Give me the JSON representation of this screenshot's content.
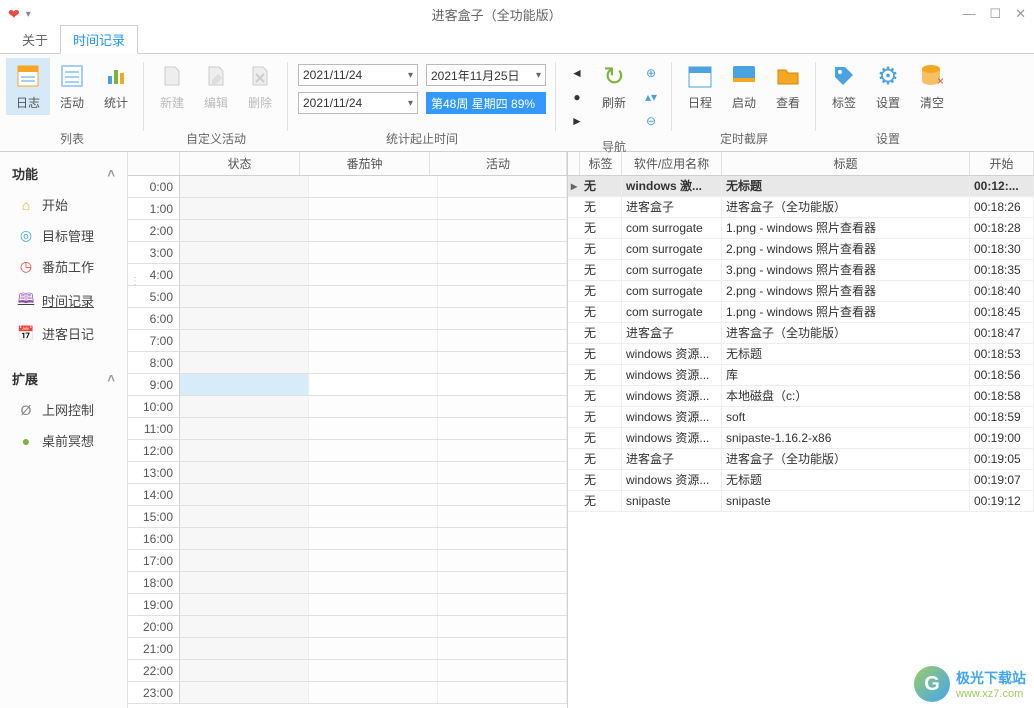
{
  "window": {
    "title": "进客盒子（全功能版）",
    "min": "—",
    "max": "☐",
    "close": "✕"
  },
  "tabs": {
    "about": "关于",
    "timelog": "时间记录"
  },
  "ribbon": {
    "list": {
      "label": "列表",
      "log": "日志",
      "activity": "活动",
      "stats": "统计"
    },
    "custom": {
      "label": "自定义活动",
      "new": "新建",
      "edit": "编辑",
      "del": "删除"
    },
    "stattime": {
      "label": "统计起止时间",
      "date1": "2021/11/24",
      "date2": "2021/11/24",
      "date3": "2021年11月25日",
      "week": "第48周 星期四 89%"
    },
    "nav": {
      "label": "导航",
      "refresh": "刷新"
    },
    "screenshot": {
      "label": "定时截屏",
      "calendar": "日程",
      "start": "启动",
      "view": "查看"
    },
    "settings": {
      "label": "设置",
      "tag": "标签",
      "set": "设置",
      "clear": "清空"
    }
  },
  "sidebar": {
    "func_hdr": "功能",
    "ext_hdr": "扩展",
    "items": [
      {
        "icon": "home-icon",
        "glyph": "⌂",
        "label": "开始"
      },
      {
        "icon": "target-icon",
        "glyph": "◎",
        "label": "目标管理"
      },
      {
        "icon": "tomato-icon",
        "glyph": "◷",
        "label": "番茄工作"
      },
      {
        "icon": "timelog-icon",
        "glyph": "🕮",
        "label": "时间记录"
      },
      {
        "icon": "diary-icon",
        "glyph": "📅",
        "label": "进客日记"
      }
    ],
    "ext_items": [
      {
        "icon": "net-icon",
        "glyph": "Ø",
        "label": "上网控制"
      },
      {
        "icon": "meditate-icon",
        "glyph": "●",
        "label": "桌前冥想"
      }
    ]
  },
  "timegrid": {
    "headers": {
      "status": "状态",
      "pomodoro": "番茄钟",
      "activity": "活动"
    },
    "hours": [
      "0:00",
      "1:00",
      "2:00",
      "3:00",
      "4:00",
      "5:00",
      "6:00",
      "7:00",
      "8:00",
      "9:00",
      "10:00",
      "11:00",
      "12:00",
      "13:00",
      "14:00",
      "15:00",
      "16:00",
      "17:00",
      "18:00",
      "19:00",
      "20:00",
      "21:00",
      "22:00",
      "23:00"
    ],
    "now_index": 9
  },
  "log": {
    "headers": {
      "tag": "标签",
      "app": "软件/应用名称",
      "title": "标题",
      "start": "开始"
    },
    "rows": [
      {
        "tag": "无",
        "app": "windows 激...",
        "title": "无标题",
        "start": "00:12:...",
        "sel": true
      },
      {
        "tag": "无",
        "app": "进客盒子",
        "title": "进客盒子（全功能版）",
        "start": "00:18:26"
      },
      {
        "tag": "无",
        "app": "com surrogate",
        "title": "1.png - windows 照片查看器",
        "start": "00:18:28"
      },
      {
        "tag": "无",
        "app": "com surrogate",
        "title": "2.png - windows 照片查看器",
        "start": "00:18:30"
      },
      {
        "tag": "无",
        "app": "com surrogate",
        "title": "3.png - windows 照片查看器",
        "start": "00:18:35"
      },
      {
        "tag": "无",
        "app": "com surrogate",
        "title": "2.png - windows 照片查看器",
        "start": "00:18:40"
      },
      {
        "tag": "无",
        "app": "com surrogate",
        "title": "1.png - windows 照片查看器",
        "start": "00:18:45"
      },
      {
        "tag": "无",
        "app": "进客盒子",
        "title": "进客盒子（全功能版）",
        "start": "00:18:47"
      },
      {
        "tag": "无",
        "app": "windows 资源...",
        "title": "无标题",
        "start": "00:18:53"
      },
      {
        "tag": "无",
        "app": "windows 资源...",
        "title": "库",
        "start": "00:18:56"
      },
      {
        "tag": "无",
        "app": "windows 资源...",
        "title": "本地磁盘（c:）",
        "start": "00:18:58"
      },
      {
        "tag": "无",
        "app": "windows 资源...",
        "title": "soft",
        "start": "00:18:59"
      },
      {
        "tag": "无",
        "app": "windows 资源...",
        "title": "snipaste-1.16.2-x86",
        "start": "00:19:00"
      },
      {
        "tag": "无",
        "app": "进客盒子",
        "title": "进客盒子（全功能版）",
        "start": "00:19:05"
      },
      {
        "tag": "无",
        "app": "windows 资源...",
        "title": "无标题",
        "start": "00:19:07"
      },
      {
        "tag": "无",
        "app": "snipaste",
        "title": "snipaste",
        "start": "00:19:12"
      }
    ]
  },
  "watermark": {
    "logo": "G",
    "line1": "极光下载站",
    "line2": "www.xz7.com"
  }
}
